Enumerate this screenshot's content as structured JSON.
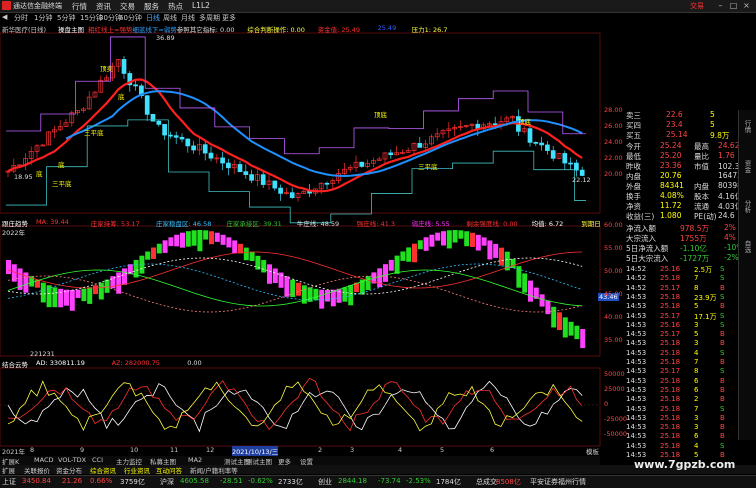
{
  "window": {
    "app_title": "通达信金融终端",
    "menu": [
      "行情",
      "资讯",
      "交易",
      "服务",
      "热点",
      "L1L2"
    ],
    "trade_label": "交易"
  },
  "periods": [
    "分时",
    "1分钟",
    "5分钟",
    "15分钟",
    "30分钟",
    "60分钟",
    "日线",
    "周线",
    "月线",
    "多周期",
    "更多"
  ],
  "active_period": "日线",
  "main_chart": {
    "stock_name": "新华医疗(日线)",
    "indicator": "操盘主图",
    "legend_items": [
      {
        "text": "粗红线上=强势",
        "color": "#ff3030"
      },
      {
        "text": "细蓝线下=弱势",
        "color": "#30a0ff"
      },
      {
        "text": "参照其它指标: 0.00",
        "color": "#dddddd"
      },
      {
        "text": "综合判断操作: 0.00",
        "color": "#ffff40"
      },
      {
        "text": "资金值: 25.49",
        "color": "#ff3030"
      },
      {
        "text": "25.49",
        "color": "#3060ff"
      },
      {
        "text": "压力1: 26.7",
        "color": "#ffff40"
      }
    ],
    "high_price": "36.89",
    "low_price": "18.95",
    "last_label": "22.12",
    "annotations": [
      "顶卖",
      "三平底",
      "三平底",
      "三平底",
      "底",
      "底",
      "顶底",
      "底",
      "顶底"
    ],
    "y_labels": [
      "28.00",
      "26.00",
      "24.00",
      "22.00",
      "20.00"
    ]
  },
  "mid_chart": {
    "title": "跟庄趋势",
    "legend_items": [
      {
        "text": "MA: 39.44",
        "color": "#ff3030"
      },
      {
        "text": "庄家持筹: 53.17",
        "color": "#ff3030"
      },
      {
        "text": "庄家稳盘区: 46.58",
        "color": "#30c0ff"
      },
      {
        "text": "庄家承接区: 39.31",
        "color": "#30c030"
      },
      {
        "text": "牛庄线: 48.59",
        "color": "#dddddd"
      },
      {
        "text": "强庄线: 41.3",
        "color": "#ff3030"
      },
      {
        "text": "弱庄线: 5.55",
        "color": "#ff30ff"
      },
      {
        "text": "剩余强度线: 0.00",
        "color": "#ff3030"
      },
      {
        "text": "均值: 6.72",
        "color": "#ffffff"
      },
      {
        "text": "到期日",
        "color": "#ffff40"
      }
    ],
    "year_label": "2022年",
    "level_label": "43.46",
    "date_label": "221231",
    "y_labels": [
      "60.00",
      "55.00",
      "50.00",
      "45.00",
      "40.00",
      "35.00"
    ]
  },
  "low_chart": {
    "title": "结合云势",
    "legend_items": [
      {
        "text": "AD: 330811.19",
        "color": "#ffffff"
      },
      {
        "text": "AZ: 282000.75",
        "color": "#ff3030"
      },
      {
        "text": "0.00",
        "color": "#dddddd"
      }
    ],
    "y_labels": [
      "50000",
      "25000",
      "0",
      "-25000",
      "-50000"
    ]
  },
  "quote_panel": {
    "rows1": [
      {
        "label": "卖三",
        "val": "22.6",
        "vol": "5"
      },
      {
        "label": "买四",
        "val": "23.4",
        "vol": "5"
      },
      {
        "label": "买五",
        "val": "25.14",
        "vol": "9.8万"
      }
    ],
    "stats": [
      {
        "l1": "今开",
        "v1": "25.24",
        "l2": "最高",
        "v2": "24.62"
      },
      {
        "l1": "最低",
        "v1": "25.20",
        "l2": "量比",
        "v2": "1.76"
      },
      {
        "l1": "昨收",
        "v1": "23.36",
        "l2": "市值",
        "v2": "102.3亿"
      },
      {
        "l1": "内盘",
        "v1": "20.76",
        "l2": "",
        "v2": "164739"
      },
      {
        "l1": "外盘",
        "v1": "84341",
        "l2": "内盘",
        "v2": "80398"
      },
      {
        "l1": "换手",
        "v1": "4.08%",
        "l2": "股本",
        "v2": "4.16亿"
      },
      {
        "l1": "净资",
        "v1": "11.72",
        "l2": "流通",
        "v2": "4.03亿"
      },
      {
        "l1": "收益(三)",
        "v1": "1.080",
        "l2": "PE(动)",
        "v2": "24.6"
      }
    ],
    "flows": [
      {
        "label": "净流入额",
        "val": "978.5万",
        "pct": "2%"
      },
      {
        "label": "大宗流入",
        "val": "1755万",
        "pct": "4%"
      },
      {
        "label": "5日净流入额",
        "val": "-1.10亿",
        "pct": "-10%"
      },
      {
        "label": "5日大宗流入",
        "val": "-1727万",
        "pct": "-2%"
      }
    ],
    "ticks": [
      {
        "t": "14:52",
        "p": "25.16",
        "v": "2.5万",
        "f": "S"
      },
      {
        "t": "14:52",
        "p": "25.18",
        "v": "7",
        "f": "S"
      },
      {
        "t": "14:52",
        "p": "25.17",
        "v": "8",
        "f": "B"
      },
      {
        "t": "14:53",
        "p": "25.18",
        "v": "23.9万",
        "f": "S"
      },
      {
        "t": "14:53",
        "p": "25.18",
        "v": "5",
        "f": "B"
      },
      {
        "t": "14:53",
        "p": "25.17",
        "v": "17.1万",
        "f": "S"
      },
      {
        "t": "14:53",
        "p": "25.16",
        "v": "3",
        "f": "S"
      },
      {
        "t": "14:53",
        "p": "25.17",
        "v": "5",
        "f": "B"
      },
      {
        "t": "14:53",
        "p": "25.18",
        "v": "3",
        "f": "B"
      },
      {
        "t": "14:53",
        "p": "25.18",
        "v": "4",
        "f": "S"
      },
      {
        "t": "14:53",
        "p": "25.18",
        "v": "7",
        "f": "B"
      },
      {
        "t": "14:53",
        "p": "25.17",
        "v": "8",
        "f": "S"
      },
      {
        "t": "14:53",
        "p": "25.18",
        "v": "6",
        "f": "B"
      },
      {
        "t": "14:53",
        "p": "25.18",
        "v": "6",
        "f": "B"
      },
      {
        "t": "14:53",
        "p": "25.18",
        "v": "2",
        "f": "B"
      },
      {
        "t": "14:53",
        "p": "25.18",
        "v": "7",
        "f": "S"
      },
      {
        "t": "14:53",
        "p": "25.18",
        "v": "3",
        "f": "B"
      },
      {
        "t": "14:53",
        "p": "25.18",
        "v": "3",
        "f": "B"
      },
      {
        "t": "14:53",
        "p": "25.18",
        "v": "6",
        "f": "B"
      },
      {
        "t": "14:53",
        "p": "25.18",
        "v": "4",
        "f": "S"
      },
      {
        "t": "14:53",
        "p": "25.18",
        "v": "5",
        "f": "B"
      }
    ]
  },
  "bottom_tabs_1": [
    "2021年",
    "8",
    "9",
    "10",
    "11",
    "12",
    "2021/10/13/三",
    "2",
    "3",
    "4",
    "5",
    "6",
    "模板"
  ],
  "bottom_tabs_2": [
    "扩展K",
    "MACD",
    "VOL-TDX",
    "CCI",
    "主力监控",
    "私募主图",
    "MA2",
    "测试主图",
    "测试主图",
    "更多",
    "设置"
  ],
  "bottom_tabs_3": [
    "扩展",
    "关联报价",
    "资金分布",
    "综合资讯",
    "行业资讯",
    "互动问答",
    "新闻/户籍利率等"
  ],
  "ticker": [
    {
      "label": "上证",
      "val": "3450.84",
      "chg": "21.26",
      "pct": "0.66%",
      "amt": "3759亿"
    },
    {
      "label": "沪深",
      "val": "4605.58",
      "chg": "-28.51",
      "pct": "-0.62%",
      "amt": "2733亿"
    },
    {
      "label": "创业",
      "val": "2844.18",
      "chg": "-73.74",
      "pct": "-2.53%",
      "amt": "1784亿"
    },
    {
      "label": "总成交",
      "val": "8508亿"
    }
  ],
  "ticker_right": "平安证券福州行情",
  "watermark": "www.7gpzb.com",
  "sidebar": [
    "行情",
    "资金",
    "分析",
    "自选"
  ]
}
